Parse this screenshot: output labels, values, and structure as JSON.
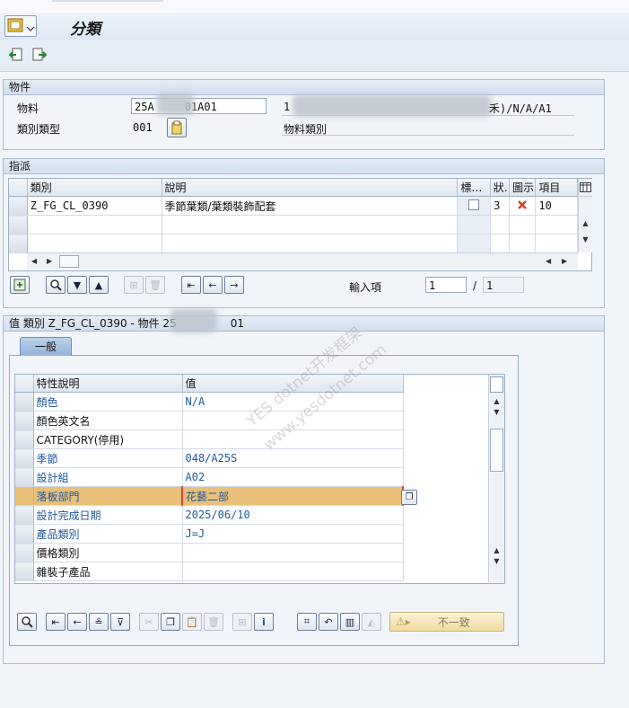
{
  "window": {
    "title": "分類"
  },
  "toolbar": {
    "prev_icon": "prev-object-icon",
    "next_icon": "next-object-icon"
  },
  "object_group": {
    "title": "物件",
    "material_label": "物料",
    "material_value": "25A",
    "material_value_suffix": "01A01",
    "material_desc_prefix": "1",
    "material_desc_suffix": "禾)/N/A/A1",
    "class_type_label": "類別類型",
    "class_type_value": "001",
    "class_type_desc": "物料類別"
  },
  "assign_group": {
    "title": "指派",
    "columns": [
      "類別",
      "說明",
      "標…",
      "狀.",
      "圖示",
      "項目"
    ],
    "rows": [
      {
        "class": "Z_FG_CL_0390",
        "desc": "季節葉類/葉類裝飾配套",
        "status": "3",
        "item": "10"
      }
    ],
    "entry_label": "輸入項",
    "entry_current": "1",
    "entry_separator": "/",
    "entry_total": "1"
  },
  "values_group": {
    "title_prefix": "值 類別 Z_FG_CL_0390 - 物件 25",
    "title_suffix": "01",
    "tab_label": "一般",
    "columns": [
      "特性說明",
      "值"
    ],
    "rows": [
      {
        "name": "顏色",
        "value": "N/A",
        "blue": true
      },
      {
        "name": "顏色英文名",
        "value": "",
        "blue": false
      },
      {
        "name": "CATEGORY(停用)",
        "value": "",
        "blue": false
      },
      {
        "name": "季節",
        "value": "048/A25S",
        "blue": true
      },
      {
        "name": "設計組",
        "value": "A02",
        "blue": true
      },
      {
        "name": "落板部門",
        "value": "花藝二部",
        "blue": true,
        "selected": true
      },
      {
        "name": "設計完成日期",
        "value": "2025/06/10",
        "blue": true
      },
      {
        "name": "產品類別",
        "value": "J=J",
        "blue": true
      },
      {
        "name": "價格類別",
        "value": "",
        "blue": false
      },
      {
        "name": "雜裝子產品",
        "value": "",
        "blue": false
      }
    ],
    "inconsistent_button": "不一致"
  },
  "watermark": {
    "line1": "YES dotnet开发框架",
    "line2": "www.yesdotnet.com"
  },
  "colors": {
    "selected_row": "#e8c07a",
    "accent_blue": "#1e5aa0",
    "delete_red": "#d2442c"
  }
}
